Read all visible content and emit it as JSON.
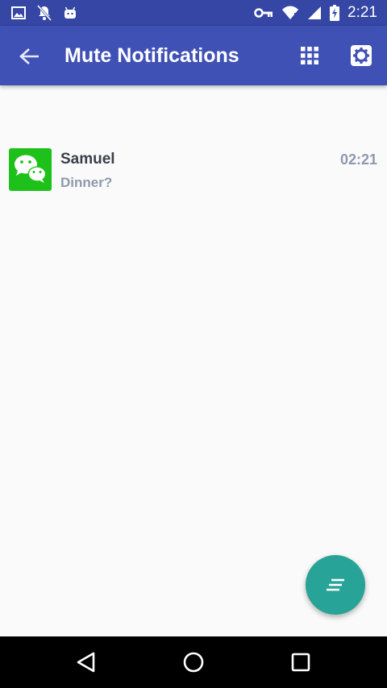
{
  "status_bar": {
    "time": "2:21",
    "left_icons": [
      "image-icon",
      "notifications-off-icon",
      "android-icon"
    ],
    "right_icons": [
      "vpn-key-icon",
      "wifi-icon",
      "signal-icon",
      "battery-charging-icon"
    ]
  },
  "app_bar": {
    "title": "Mute Notifications",
    "color": "#3f51b5",
    "actions": [
      "grid-icon",
      "settings-icon"
    ]
  },
  "notifications": [
    {
      "app_icon": "wechat-icon",
      "sender": "Samuel",
      "message": "Dinner?",
      "time": "02:21"
    }
  ],
  "fab": {
    "icon": "sort-icon",
    "color": "#27a397"
  },
  "nav_bar": {
    "buttons": [
      "back-triangle-icon",
      "home-circle-icon",
      "recents-square-icon"
    ]
  }
}
